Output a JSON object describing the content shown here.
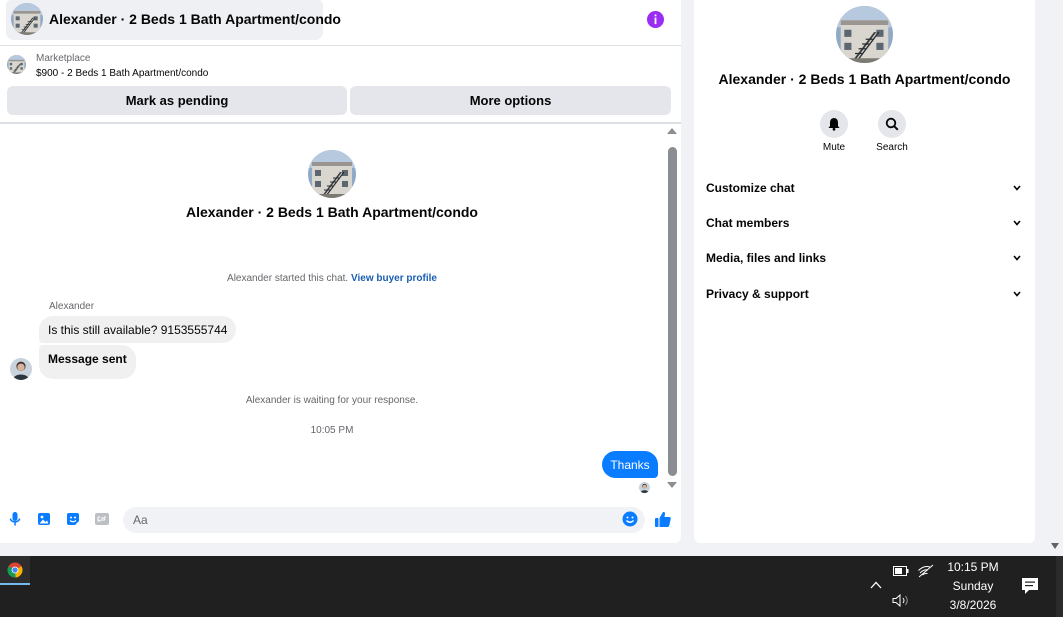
{
  "chat": {
    "header_title": "Alexander · 2 Beds 1 Bath Apartment/condo",
    "marketplace_label": "Marketplace",
    "listing_price_title": "$900 - 2 Beds 1 Bath Apartment/condo",
    "mark_pending_label": "Mark as pending",
    "more_options_label": "More options",
    "conversation_title": "Alexander · 2 Beds 1 Bath Apartment/condo",
    "started_text": "Alexander started this chat.",
    "view_profile_link": "View buyer profile",
    "sender_name": "Alexander",
    "messages": [
      {
        "direction": "in",
        "text": "Is this still available? 9153555744"
      },
      {
        "direction": "in",
        "text": "Message sent"
      },
      {
        "direction": "out",
        "text": "Thanks"
      }
    ],
    "waiting_text": "Alexander is waiting for your response.",
    "timestamp": "10:05 PM",
    "composer_placeholder": "Aa",
    "accent_color": "#0a7cff",
    "info_icon_color": "#9b2df3"
  },
  "info_panel": {
    "title": "Alexander · 2 Beds 1 Bath Apartment/condo",
    "actions": [
      {
        "label": "Mute",
        "icon": "bell-icon"
      },
      {
        "label": "Search",
        "icon": "search-icon"
      }
    ],
    "sections": [
      "Customize chat",
      "Chat members",
      "Media, files and links",
      "Privacy & support"
    ]
  },
  "taskbar": {
    "time": "10:15 PM",
    "day": "Sunday",
    "date": "3/8/2026"
  }
}
